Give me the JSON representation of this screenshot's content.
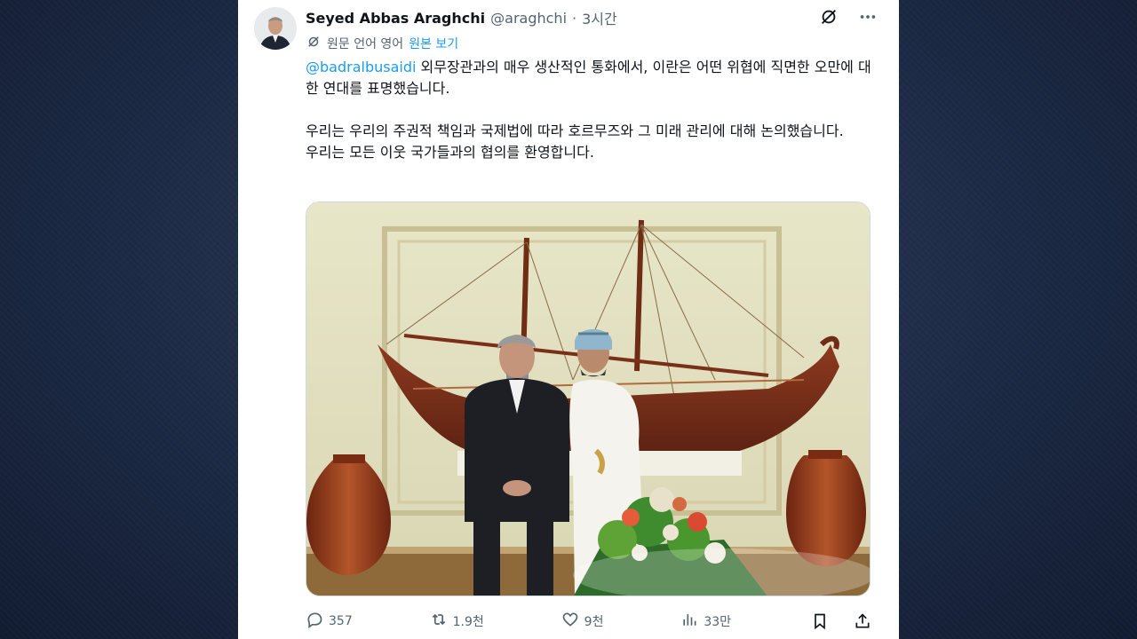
{
  "post": {
    "author_name": "Seyed Abbas Araghchi",
    "handle": "@araghchi",
    "separator": "·",
    "time": "3시간",
    "translate": {
      "source_label": "원문 언어 영어",
      "show_original": "원본 보기"
    },
    "body": {
      "mention": "@badralbusaidi",
      "line1_rest": " 외무장관과의 매우 생산적인 통화에서, 이란은 어떤 위협에 직면한 오만에 대한 연대를 표명했습니다.",
      "para2": "우리는 우리의 주권적 책임과 국제법에 따라 호르무즈와 그 미래 관리에 대해 논의했습니다.",
      "para3": "우리는 모든 이웃 국가들과의 협의를 환영합니다."
    },
    "stats": {
      "replies": "357",
      "reposts": "1.9천",
      "likes": "9천",
      "views": "33만"
    }
  },
  "icons": {
    "grok": "grok-icon",
    "more": "more-icon",
    "translate": "translate-icon",
    "reply": "reply-icon",
    "repost": "repost-icon",
    "like": "like-icon",
    "views": "views-icon",
    "bookmark": "bookmark-icon",
    "share": "share-icon"
  },
  "colors": {
    "accent": "#1d9bf0",
    "text": "#0f1419",
    "muted": "#536471",
    "background_outer": "#1c2a45"
  }
}
